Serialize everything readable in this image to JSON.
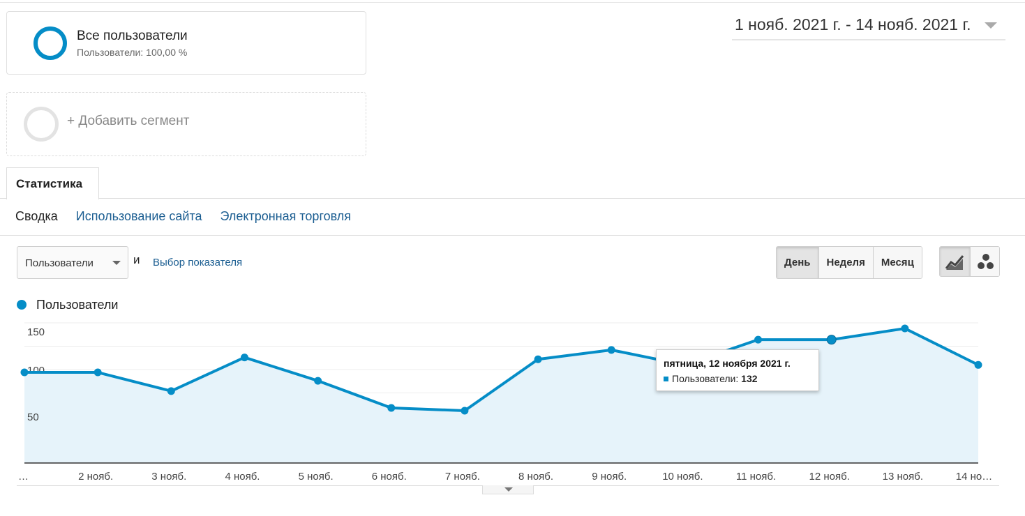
{
  "segments": {
    "active": {
      "title": "Все пользователи",
      "subtitle": "Пользователи: 100,00 %"
    },
    "add_label": "+ Добавить сегмент"
  },
  "date_range": "1 нояб. 2021 г. - 14 нояб. 2021 г.",
  "tabs": [
    {
      "label": "Статистика",
      "active": true
    }
  ],
  "subnav": [
    "Сводка",
    "Использование сайта",
    "Электронная торговля"
  ],
  "metric": {
    "selected": "Пользователи",
    "and": "и",
    "choose_link": "Выбор показателя"
  },
  "period_buttons": [
    "День",
    "Неделя",
    "Месяц"
  ],
  "view_icons": [
    "line-chart-icon",
    "motion-chart-icon"
  ],
  "legend": "Пользователи",
  "colors": {
    "series": "#058dc7",
    "fill": "#e6f3fa",
    "link": "#1a5d91"
  },
  "tooltip": {
    "date": "пятница, 12 ноября 2021 г.",
    "label": "Пользователи:",
    "value": "132"
  },
  "chart_data": {
    "type": "area",
    "x": [
      "…",
      "2 нояб.",
      "3 нояб.",
      "4 нояб.",
      "5 нояб.",
      "6 нояб.",
      "7 нояб.",
      "8 нояб.",
      "9 нояб.",
      "10 нояб.",
      "11 нояб.",
      "12 нояб.",
      "13 нояб.",
      "14 но…"
    ],
    "series": [
      {
        "name": "Пользователи",
        "values": [
          97,
          97,
          77,
          113,
          88,
          59,
          56,
          111,
          121,
          105,
          132,
          132,
          144,
          105
        ]
      }
    ],
    "y_ticks": [
      50,
      100,
      150
    ],
    "ylim": [
      0,
      150
    ],
    "grid": true
  }
}
